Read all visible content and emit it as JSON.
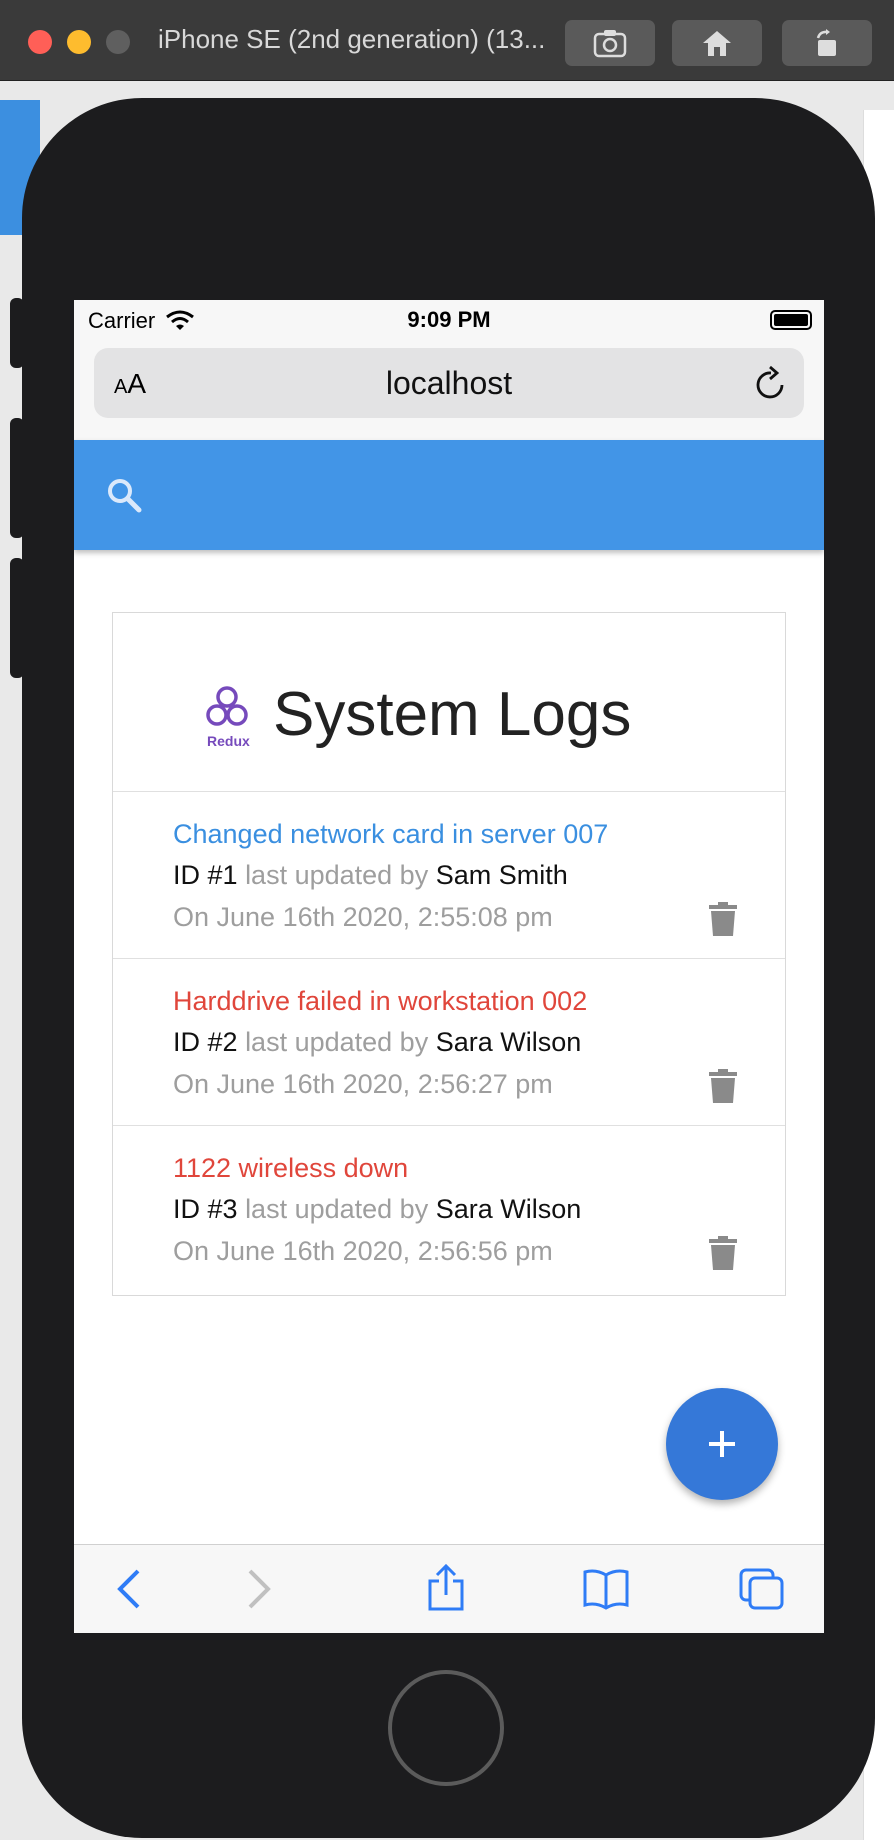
{
  "simulator": {
    "title": "iPhone SE (2nd generation) (13...",
    "colors": {
      "close": "#ff5f57",
      "minimize": "#febc2e",
      "zoom": "#5f5f5f"
    },
    "buttons": [
      "screenshot-icon",
      "home-icon",
      "rotate-icon"
    ]
  },
  "status_bar": {
    "carrier": "Carrier",
    "time": "9:09 PM"
  },
  "browser": {
    "text_size_label": "AA",
    "url": "localhost"
  },
  "app": {
    "accent": "#4295e7",
    "title": "System Logs",
    "logo_text": "Redux",
    "logs": [
      {
        "message": "Changed network card in server 007",
        "message_color": "#3a8fe0",
        "id_label": "ID #1",
        "updated_by_label": "last updated by",
        "tech": "Sam Smith",
        "date": "On June 16th 2020, 2:55:08 pm"
      },
      {
        "message": "Harddrive failed in workstation 002",
        "message_color": "#e0463b",
        "id_label": "ID #2",
        "updated_by_label": "last updated by",
        "tech": "Sara Wilson",
        "date": "On June 16th 2020, 2:56:27 pm"
      },
      {
        "message": "1122 wireless down",
        "message_color": "#e0463b",
        "id_label": "ID #3",
        "updated_by_label": "last updated by",
        "tech": "Sara Wilson",
        "date": "On June 16th 2020, 2:56:56 pm"
      }
    ],
    "fab_label": "+"
  }
}
